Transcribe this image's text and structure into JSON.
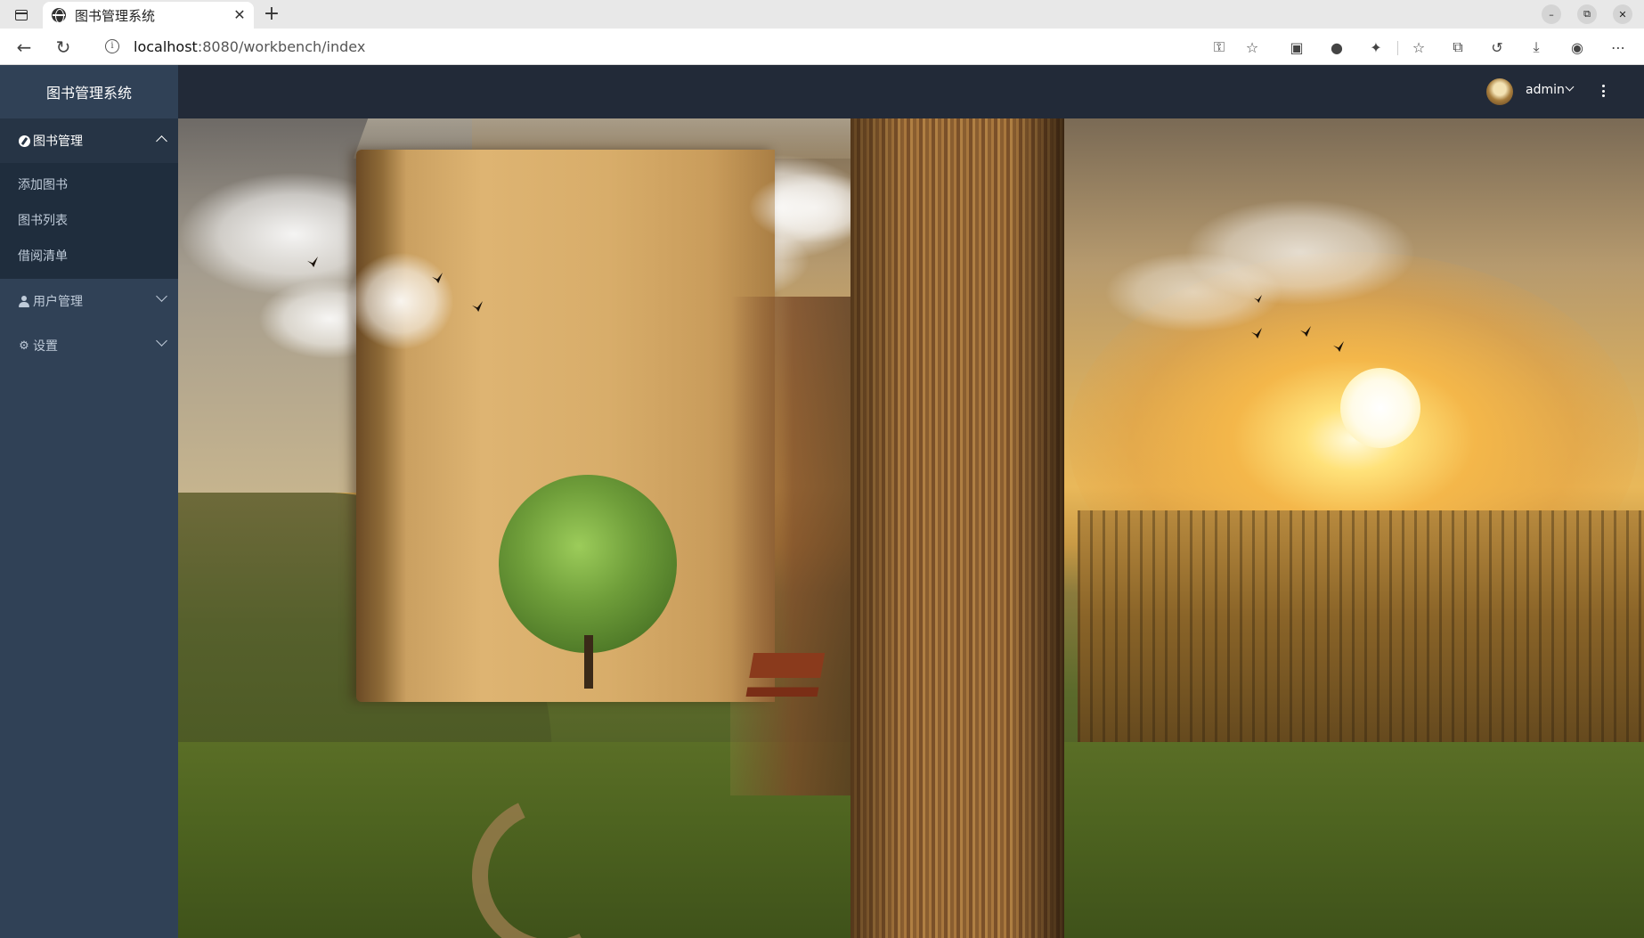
{
  "browser": {
    "tab_title": "图书管理系统",
    "url_host": "localhost",
    "url_rest": ":8080/workbench/index",
    "icons": [
      "sidebar-toggle-icon",
      "globe-icon",
      "close-icon",
      "plus-icon",
      "back-icon",
      "reload-icon",
      "info-icon",
      "key-icon",
      "star-add-icon",
      "extension-icon",
      "cookie-icon",
      "puzzle-icon",
      "favorites-icon",
      "collections-icon",
      "history-icon",
      "download-icon",
      "profile-icon",
      "more-icon",
      "minimize-icon",
      "restore-icon",
      "window-close-icon"
    ]
  },
  "app": {
    "logo_title": "图书管理系统",
    "menu": [
      {
        "label": "图书管理",
        "icon": "compass-icon",
        "expanded": true,
        "children": [
          "添加图书",
          "图书列表",
          "借阅清单"
        ]
      },
      {
        "label": "用户管理",
        "icon": "user-icon",
        "expanded": false
      },
      {
        "label": "设置",
        "icon": "gear-icon",
        "expanded": false
      }
    ],
    "navbar": {
      "username": "admin"
    },
    "colors": {
      "sidebar_bg": "#304156",
      "submenu_bg": "#1f2d3d",
      "navbar_bg": "#222a38",
      "menu_text": "#bfcbd9"
    },
    "hero_image": "open-book-landscape-illustration"
  }
}
